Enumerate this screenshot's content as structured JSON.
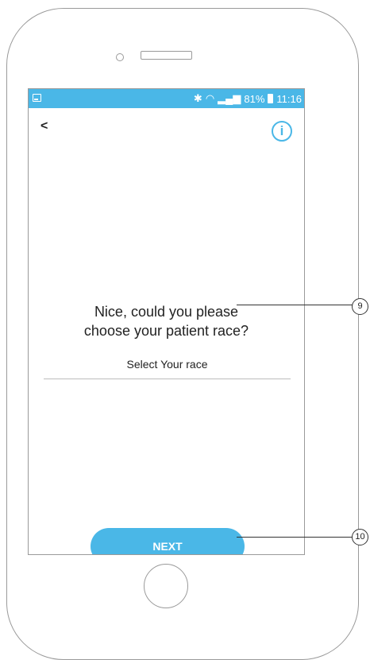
{
  "status_bar": {
    "bluetooth_icon": "bluetooth-icon",
    "wifi_icon": "wifi-icon",
    "signal_icon": "signal-icon",
    "battery": "81%",
    "time": "11:16"
  },
  "header": {
    "back": "<",
    "info": "i"
  },
  "main": {
    "question_line1": "Nice, could you please",
    "question_line2": "choose your patient race?",
    "select_placeholder": "Select Your race"
  },
  "footer": {
    "next_label": "NEXT"
  },
  "annotations": {
    "callout_1": "9",
    "callout_2": "10"
  },
  "colors": {
    "accent": "#4ab7e7",
    "text": "#222222"
  }
}
